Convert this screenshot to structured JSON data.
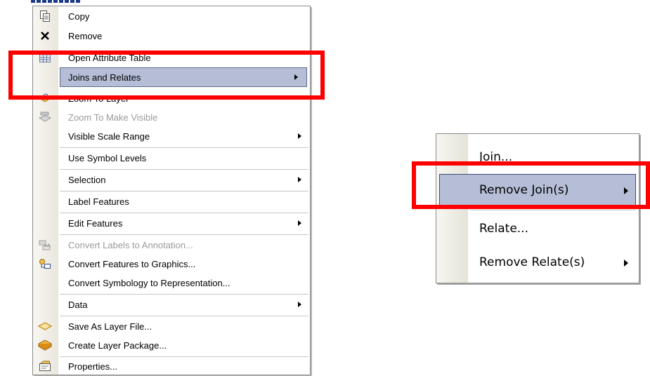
{
  "context_menu": {
    "items": [
      {
        "label": "Copy",
        "icon": "copy-icon"
      },
      {
        "label": "Remove",
        "icon": "remove-x-icon"
      },
      {
        "label": "Open Attribute Table",
        "icon": "table-icon"
      },
      {
        "label": "Joins and Relates",
        "submenu": true,
        "highlighted": true
      },
      {
        "label": "Zoom To Layer",
        "icon": "zoom-to-layer-icon"
      },
      {
        "label": "Zoom To Make Visible",
        "icon": "zoom-visible-icon",
        "disabled": true
      },
      {
        "label": "Visible Scale Range",
        "submenu": true
      },
      {
        "label": "Use Symbol Levels"
      },
      {
        "label": "Selection",
        "submenu": true
      },
      {
        "label": "Label Features"
      },
      {
        "label": "Edit Features",
        "submenu": true
      },
      {
        "label": "Convert Labels to Annotation...",
        "icon": "convert-labels-icon",
        "disabled": true
      },
      {
        "label": "Convert Features to Graphics...",
        "icon": "convert-graphics-icon"
      },
      {
        "label": "Convert Symbology to Representation..."
      },
      {
        "label": "Data",
        "submenu": true
      },
      {
        "label": "Save As Layer File...",
        "icon": "layer-file-icon"
      },
      {
        "label": "Create Layer Package...",
        "icon": "layer-package-icon"
      },
      {
        "label": "Properties...",
        "icon": "properties-icon"
      }
    ]
  },
  "submenu": {
    "items": [
      {
        "label": "Join..."
      },
      {
        "label": "Remove Join(s)",
        "submenu": true,
        "highlighted": true
      },
      {
        "label": "Relate..."
      },
      {
        "label": "Remove Relate(s)",
        "submenu": true
      }
    ]
  },
  "colors": {
    "highlight": "#b5bed6",
    "annotation": "#ff0000",
    "disabled_text": "#9a9a9a"
  }
}
